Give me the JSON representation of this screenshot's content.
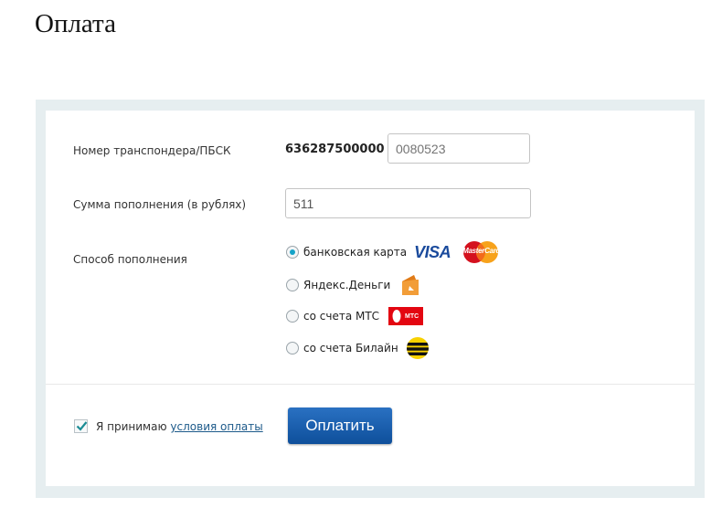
{
  "page": {
    "title": "Оплата"
  },
  "form": {
    "transponder": {
      "label": "Номер транспондера/ПБСК",
      "prefix": "636287500000",
      "placeholder": "0080523"
    },
    "amount": {
      "label": "Сумма пополнения (в рублях)",
      "value": "511"
    },
    "method": {
      "label": "Способ пополнения",
      "options": [
        {
          "label": "банковская карта",
          "selected": true,
          "logos": [
            "visa-logo",
            "mastercard-logo"
          ]
        },
        {
          "label": "Яндекс.Деньги",
          "selected": false,
          "logos": [
            "yandex-money-logo"
          ]
        },
        {
          "label": "со счета МТС",
          "selected": false,
          "logos": [
            "mts-logo"
          ]
        },
        {
          "label": "со счета Билайн",
          "selected": false,
          "logos": [
            "beeline-logo"
          ]
        }
      ]
    },
    "logos": {
      "visa": "VISA",
      "mastercard": "MasterCard",
      "mts": "МТС"
    },
    "agreement": {
      "checked": true,
      "text": "Я принимаю",
      "link": "условия оплаты"
    },
    "submit_label": "Оплатить"
  },
  "colors": {
    "accent": "#15a3c8",
    "button": "#0e4f9b",
    "panel_border": "#e6eef0",
    "link": "#1d5a8a"
  }
}
